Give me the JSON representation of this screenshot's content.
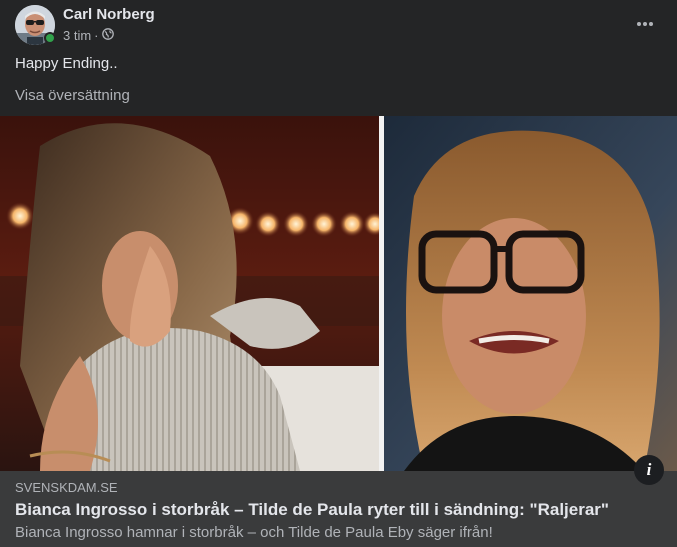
{
  "post": {
    "author_name": "Carl Norberg",
    "time": "3 tim",
    "separator": "·",
    "audience_icon": "globe-icon",
    "more_icon": "more-horizontal-icon",
    "text": "Happy Ending..",
    "translate_label": "Visa översättning"
  },
  "link_preview": {
    "domain": "SVENSKDAM.SE",
    "title": "Bianca Ingrosso i storbråk – Tilde de Paula ryter till i sändning: \"Raljerar\"",
    "description": "Bianca Ingrosso hamnar i storbråk – och Tilde de Paula Eby säger ifrån!",
    "info_label": "i"
  },
  "colors": {
    "card_background": "#242526",
    "link_background": "#3a3b3c",
    "primary_text": "#e4e6eb",
    "secondary_text": "#b0b3b8",
    "online_status": "#31a24c"
  }
}
